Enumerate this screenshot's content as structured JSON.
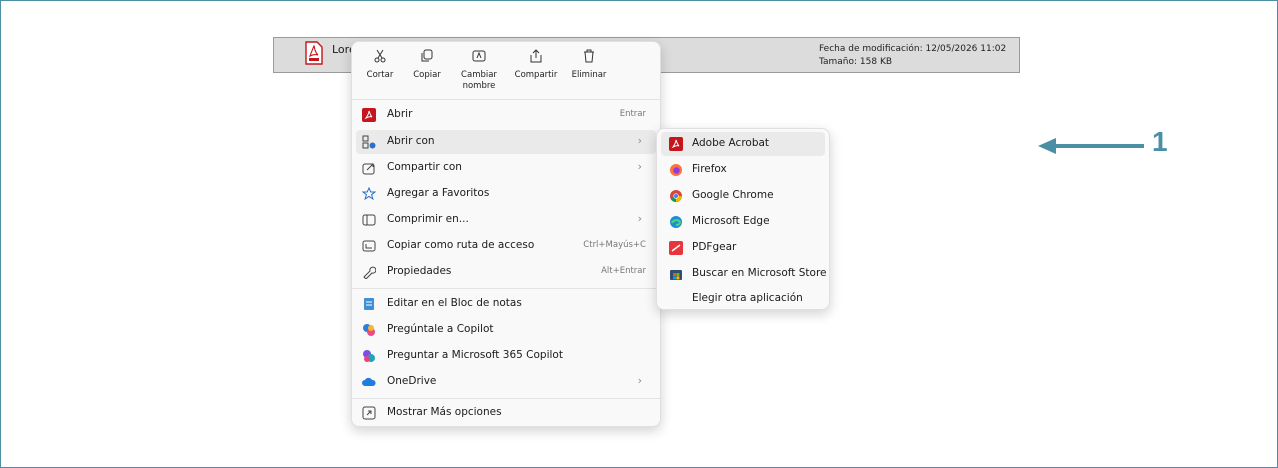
{
  "file": {
    "name": "Lore",
    "modified": "Fecha de modificación: 12/05/2026 11:02",
    "size": "Tamaño: 158 KB"
  },
  "actions": [
    {
      "label": "Cortar",
      "icon": "scissors-icon"
    },
    {
      "label": "Copiar",
      "icon": "copy-icon"
    },
    {
      "label": "Cambiar nombre",
      "icon": "rename-icon"
    },
    {
      "label": "Compartir",
      "icon": "share-icon"
    },
    {
      "label": "Eliminar",
      "icon": "trash-icon"
    }
  ],
  "menu": {
    "items": [
      {
        "label": "Abrir",
        "shortcut": "Entrar",
        "icon": "pdf-icon"
      },
      {
        "label": "Abrir con",
        "submenu": true,
        "icon": "open-with-icon"
      },
      {
        "label": "Compartir con",
        "submenu": true,
        "icon": "share-icon"
      },
      {
        "label": "Agregar a Favoritos",
        "icon": "star-icon"
      },
      {
        "label": "Comprimir en...",
        "submenu": true,
        "icon": "zip-icon"
      },
      {
        "label": "Copiar como ruta de acceso",
        "shortcut": "Ctrl+Mayús+C",
        "icon": "path-icon"
      },
      {
        "label": "Propiedades",
        "shortcut": "Alt+Entrar",
        "icon": "wrench-icon"
      },
      {
        "label": "Editar en el Bloc de notas",
        "icon": "notepad-icon"
      },
      {
        "label": "Pregúntale a Copilot",
        "icon": "copilot-icon"
      },
      {
        "label": "Preguntar a Microsoft 365 Copilot",
        "icon": "m365-copilot-icon"
      },
      {
        "label": "OneDrive",
        "submenu": true,
        "icon": "onedrive-icon"
      },
      {
        "label": "Mostrar Más opciones",
        "icon": "more-options-icon"
      }
    ]
  },
  "submenu": {
    "items": [
      {
        "label": "Adobe Acrobat",
        "icon": "acrobat-icon"
      },
      {
        "label": "Firefox",
        "icon": "firefox-icon"
      },
      {
        "label": "Google Chrome",
        "icon": "chrome-icon"
      },
      {
        "label": "Microsoft Edge",
        "icon": "edge-icon"
      },
      {
        "label": "PDFgear",
        "icon": "pdfgear-icon"
      },
      {
        "label": "Buscar en Microsoft Store",
        "icon": "store-icon"
      },
      {
        "label": "Elegir otra aplicación",
        "icon": ""
      }
    ]
  },
  "callout": {
    "label": "1"
  },
  "colors": {
    "accent": "#4a8fa3",
    "pdf_red": "#c4161c"
  }
}
